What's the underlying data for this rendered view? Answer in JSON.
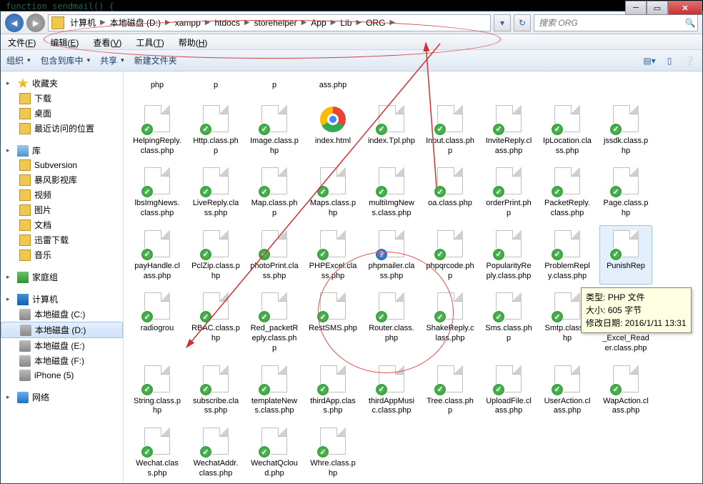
{
  "code_snippet": "function sendmail() {",
  "breadcrumb": [
    "计算机",
    "本地磁盘 (D:)",
    "xampp",
    "htdocs",
    "storehelper",
    "App",
    "Lib",
    "ORG"
  ],
  "search_placeholder": "搜索 ORG",
  "menubar": [
    {
      "label": "文件",
      "accel": "F"
    },
    {
      "label": "编辑",
      "accel": "E"
    },
    {
      "label": "查看",
      "accel": "V"
    },
    {
      "label": "工具",
      "accel": "T"
    },
    {
      "label": "帮助",
      "accel": "H"
    }
  ],
  "toolbar": {
    "organize": "组织",
    "include": "包含到库中",
    "share": "共享",
    "newfolder": "新建文件夹"
  },
  "sidebar": {
    "fav": {
      "title": "收藏夹",
      "items": [
        "下载",
        "桌面",
        "最近访问的位置"
      ]
    },
    "lib": {
      "title": "库",
      "items": [
        "Subversion",
        "暴风影视库",
        "视频",
        "图片",
        "文档",
        "迅雷下载",
        "音乐"
      ]
    },
    "home": "家庭组",
    "computer": {
      "title": "计算机",
      "items": [
        "本地磁盘 (C:)",
        "本地磁盘 (D:)",
        "本地磁盘 (E:)",
        "本地磁盘 (F:)",
        "iPhone (5)"
      ]
    },
    "network": "网络"
  },
  "files_partial": [
    "php",
    "p",
    "p",
    "ass.php"
  ],
  "files": [
    {
      "name": "HelpingReply.class.php",
      "badge": "ok"
    },
    {
      "name": "Http.class.php",
      "badge": "ok"
    },
    {
      "name": "Image.class.php",
      "badge": "ok"
    },
    {
      "name": "index.html",
      "badge": "chrome"
    },
    {
      "name": "index.Tpl.php",
      "badge": "ok"
    },
    {
      "name": "Input.class.php",
      "badge": "ok"
    },
    {
      "name": "InviteReply.class.php",
      "badge": "ok"
    },
    {
      "name": "IpLocation.class.php",
      "badge": "ok"
    },
    {
      "name": "jssdk.class.php",
      "badge": "ok"
    },
    {
      "name": "lbsImgNews.class.php",
      "badge": "ok"
    },
    {
      "name": "LiveReply.class.php",
      "badge": "ok"
    },
    {
      "name": "Map.class.php",
      "badge": "ok"
    },
    {
      "name": "Maps.class.php",
      "badge": "ok"
    },
    {
      "name": "multiImgNews.class.php",
      "badge": "ok"
    },
    {
      "name": "oa.class.php",
      "badge": "ok"
    },
    {
      "name": "orderPrint.php",
      "badge": "ok"
    },
    {
      "name": "PacketReply.class.php",
      "badge": "ok"
    },
    {
      "name": "Page.class.php",
      "badge": "ok"
    },
    {
      "name": "payHandle.class.php",
      "badge": "ok"
    },
    {
      "name": "PclZip.class.php",
      "badge": "ok"
    },
    {
      "name": "photoPrint.class.php",
      "badge": "ok"
    },
    {
      "name": "PHPExcel.class.php",
      "badge": "ok"
    },
    {
      "name": "phpmailer.class.php",
      "badge": "q"
    },
    {
      "name": "phpqrcode.php",
      "badge": "ok"
    },
    {
      "name": "PopularityReply.class.php",
      "badge": "ok"
    },
    {
      "name": "ProblemReply.class.php",
      "badge": "ok"
    },
    {
      "name": "PunishRep",
      "badge": "ok",
      "selected": true
    },
    {
      "name": "radiogrou",
      "badge": "ok"
    },
    {
      "name": "RBAC.class.php",
      "badge": "ok"
    },
    {
      "name": "Red_packetReply.class.php",
      "badge": "ok"
    },
    {
      "name": "RestSMS.php",
      "badge": "ok"
    },
    {
      "name": "Router.class.php",
      "badge": "ok"
    },
    {
      "name": "ShakeReply.class.php",
      "badge": "ok"
    },
    {
      "name": "Sms.class.php",
      "badge": "ok"
    },
    {
      "name": "Smtp.class.php",
      "badge": "ok"
    },
    {
      "name": "Spreadsheet_Excel_Reader.class.php",
      "badge": "ok"
    },
    {
      "name": "String.class.php",
      "badge": "ok"
    },
    {
      "name": "subscribe.class.php",
      "badge": "ok"
    },
    {
      "name": "templateNews.class.php",
      "badge": "ok"
    },
    {
      "name": "thirdApp.class.php",
      "badge": "ok"
    },
    {
      "name": "thirdAppMusic.class.php",
      "badge": "ok"
    },
    {
      "name": "Tree.class.php",
      "badge": "ok"
    },
    {
      "name": "UploadFile.class.php",
      "badge": "ok"
    },
    {
      "name": "UserAction.class.php",
      "badge": "ok"
    },
    {
      "name": "WapAction.class.php",
      "badge": "ok"
    },
    {
      "name": "Wechat.class.php",
      "badge": "ok"
    },
    {
      "name": "WechatAddr.class.php",
      "badge": "ok"
    },
    {
      "name": "WechatQcloud.php",
      "badge": "ok"
    },
    {
      "name": "Whre.class.php",
      "badge": "ok"
    }
  ],
  "tooltip": {
    "type_label": "类型:",
    "type_value": "PHP 文件",
    "size_label": "大小:",
    "size_value": "605 字节",
    "mod_label": "修改日期:",
    "mod_value": "2016/1/11 13:31"
  }
}
